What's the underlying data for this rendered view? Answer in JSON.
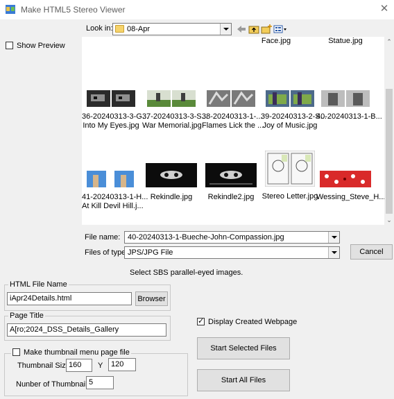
{
  "window": {
    "title": "Make HTML5 Stereo Viewer"
  },
  "lookin": {
    "label": "Look in:",
    "value": "08-Apr"
  },
  "show_preview": {
    "label": "Show Preview",
    "checked": false
  },
  "files": [
    {
      "name": "Face.jpg"
    },
    {
      "name": "Statue.jpg"
    },
    {
      "name": "36-20240313-3-G... Into My Eyes.jpg",
      "line1": "36-20240313-3-G...",
      "line2": "Into My Eyes.jpg"
    },
    {
      "name": "37-20240313-3-S... War Memorial.jpg",
      "line1": "37-20240313-3-S...",
      "line2": "War Memorial.jpg"
    },
    {
      "name": "38-20240313-1-... Flames Lick the ...",
      "line1": "38-20240313-1-...",
      "line2": "Flames Lick the ..."
    },
    {
      "name": "39-20240313-2-S... Joy of Music.jpg",
      "line1": "39-20240313-2-S...",
      "line2": "Joy of Music.jpg"
    },
    {
      "name": "40-20240313-1-B...",
      "line1": "40-20240313-1-B...",
      "line2": ""
    },
    {
      "name": "41-20240313-1-H... At Kill Devil Hill.j...",
      "line1": "41-20240313-1-H...",
      "line2": "At Kill Devil Hill.j..."
    },
    {
      "name": "Rekindle.jpg",
      "line1": "Rekindle.jpg",
      "line2": ""
    },
    {
      "name": "Rekindle2.jpg",
      "line1": "Rekindle2.jpg",
      "line2": ""
    },
    {
      "name": "Stereo Letter.jpg",
      "line1": "Stereo Letter.jpg",
      "line2": ""
    },
    {
      "name": "Wessing_Steve_H...",
      "line1": "Wessing_Steve_H...",
      "line2": ""
    }
  ],
  "filename": {
    "label": "File name:",
    "value": "40-20240313-1-Bueche-John-Compassion.jpg"
  },
  "filetype": {
    "label": "Files of type:",
    "value": "JPS/JPG File"
  },
  "cancel_label": "Cancel",
  "hint": "Select SBS parallel-eyed images.",
  "html_file": {
    "legend": "HTML File Name",
    "value": "iApr24Details.html",
    "button": "Browser"
  },
  "page_title": {
    "legend": "Page Title",
    "value": "A[ro;2024_DSS_Details_Gallery"
  },
  "display_created": {
    "label": "Display Created Webpage",
    "checked": true
  },
  "thumbnail": {
    "legend": "Make thumbnail menu page file",
    "checked": false,
    "size_label": "Thumbnail Size: X",
    "x": "160",
    "y_label": "Y",
    "y": "120",
    "count_label": "Nunber of Thumbnail(row):",
    "count": "5"
  },
  "start_selected": "Start Selected Files",
  "start_all": "Start All Files",
  "colors": {
    "accent": "#0078d7",
    "folder": "#f6d36b"
  }
}
